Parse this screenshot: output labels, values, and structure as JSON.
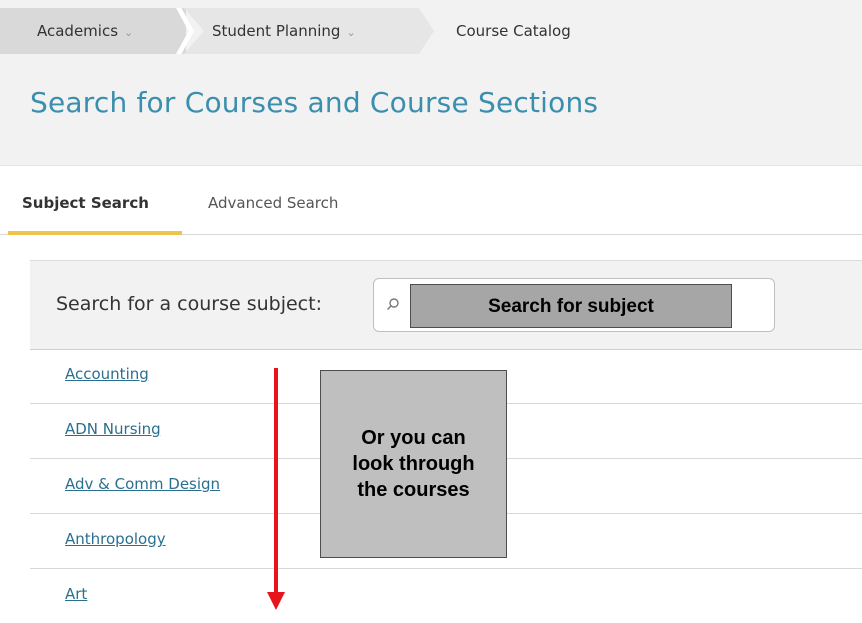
{
  "breadcrumb": {
    "items": [
      {
        "label": "Academics",
        "has_menu": true
      },
      {
        "label": "Student Planning",
        "has_menu": true
      },
      {
        "label": "Course Catalog",
        "has_menu": false
      }
    ]
  },
  "page": {
    "title": "Search for Courses and Course Sections"
  },
  "tabs": [
    {
      "label": "Subject Search",
      "active": true
    },
    {
      "label": "Advanced Search",
      "active": false
    }
  ],
  "search": {
    "label": "Search for a course subject:",
    "icon": "search-icon",
    "overlay_text": "Search for subject"
  },
  "subjects": [
    {
      "label": "Accounting"
    },
    {
      "label": "ADN Nursing"
    },
    {
      "label": "Adv & Comm Design"
    },
    {
      "label": "Anthropology"
    },
    {
      "label": "Art"
    }
  ],
  "annotation": {
    "note": "Or you can look through the courses",
    "arrow_color": "#e8141b"
  },
  "colors": {
    "title": "#3b8fae",
    "link": "#2b6f8f",
    "tab_active_underline": "#f0c34b",
    "annotation_arrow": "#e8141b"
  }
}
